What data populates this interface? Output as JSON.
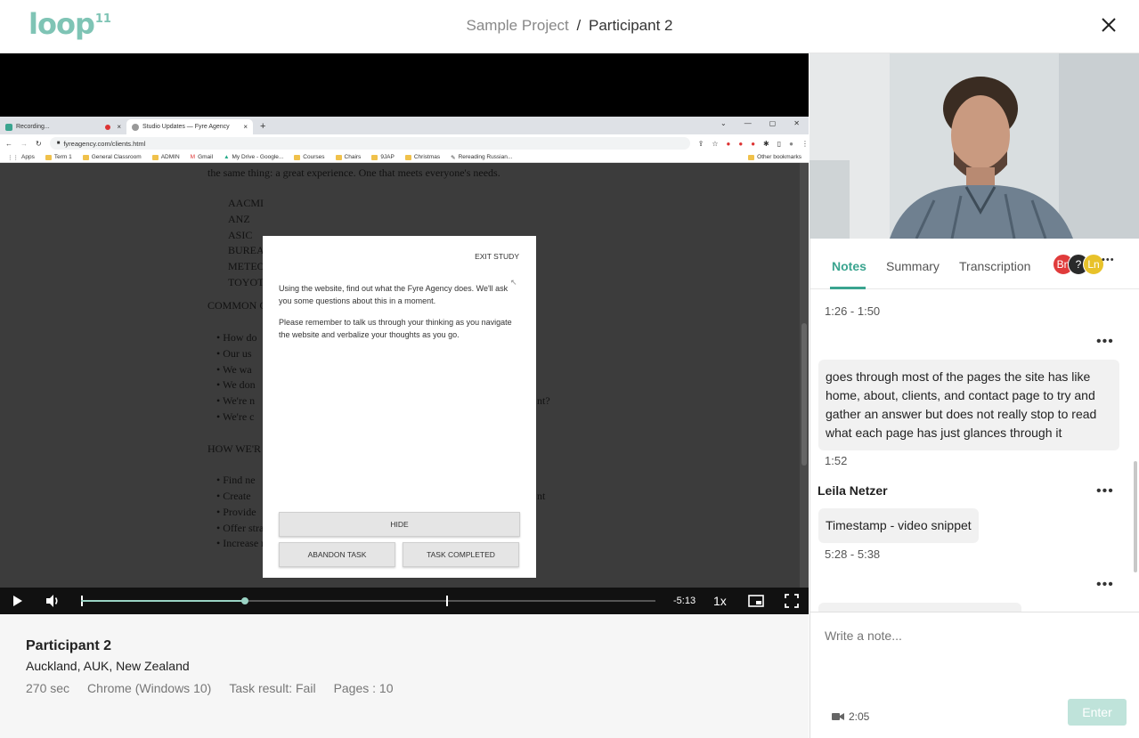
{
  "header": {
    "logo": "loop",
    "logo_sup": "11",
    "project": "Sample Project",
    "separator": "/",
    "participant": "Participant 2"
  },
  "recording": {
    "browser": {
      "tabs": [
        "Recording...",
        "Studio Updates — Fyre Agency"
      ],
      "url": "fyreagency.com/clients.html",
      "bookmarks": [
        "Apps",
        "Term 1",
        "General Classroom",
        "ADMIN",
        "Gmail",
        "My Drive - Google...",
        "Courses",
        "Chairs",
        "9JAP",
        "Christmas",
        "Rereading Russian..."
      ],
      "other_bookmarks": "Other bookmarks"
    },
    "page_text": {
      "intro": "the same thing: a great experience. One that meets everyone's needs.",
      "clients": [
        "AACMI",
        "ANZ",
        "ASIC",
        "BUREA",
        "METEO",
        "TOYOT"
      ],
      "common_heading": "COMMON C",
      "common_items": [
        "How do",
        "Our us",
        "We wa",
        "We don",
        "We're n",
        "We're c"
      ],
      "common_tail": "nt?",
      "how_heading": "HOW WE'R",
      "how_items": [
        "Find ne",
        "Create",
        "Provide",
        "Offer strategic direction and governance structure",
        "Increase revenue and decrease support costs"
      ],
      "how_tail": "nt"
    },
    "modal": {
      "exit": "EXIT STUDY",
      "task_text": "Using the website, find out what the Fyre Agency does. We'll ask you some questions about this in a moment.",
      "reminder": "Please remember to talk us through your thinking as you navigate the website and verbalize your thoughts as you go.",
      "hide": "HIDE",
      "abandon": "ABANDON TASK",
      "completed": "TASK COMPLETED"
    }
  },
  "player": {
    "time_remaining": "-5:13",
    "speed": "1x",
    "progress_fraction": 0.285,
    "marker_fraction": 0.635
  },
  "participant": {
    "name": "Participant 2",
    "location": "Auckland, AUK, New Zealand",
    "duration": "270 sec",
    "browser": "Chrome (Windows 10)",
    "task_result": "Task result: Fail",
    "pages": "Pages : 10"
  },
  "panel": {
    "tabs": [
      "Notes",
      "Summary",
      "Transcription"
    ],
    "active_tab": "Notes",
    "avatars": [
      {
        "label": "Bn",
        "color": "#e03b3b"
      },
      {
        "label": "?",
        "color": "#2a2a2a"
      },
      {
        "label": "Ln",
        "color": "#e8c22a"
      }
    ],
    "more": "•••"
  },
  "notes": {
    "range1": "1:26  -  1:50",
    "note2_text": "goes through most of the pages the site has like home, about, clients, and contact page to try and gather an answer but does not really stop to read what each page has just glances through it",
    "note2_time": "1:52",
    "author3": "Leila Netzer",
    "note3_text": "Timestamp - video snippet",
    "range3": "5:28  -  5:38"
  },
  "compose": {
    "placeholder": "Write a note...",
    "cam_time": "2:05",
    "enter": "Enter"
  },
  "colors": {
    "accent": "#3aa48f",
    "logo": "#7fc4b5",
    "progress": "#9ad3c4",
    "enter_disabled": "#bfe3da"
  }
}
